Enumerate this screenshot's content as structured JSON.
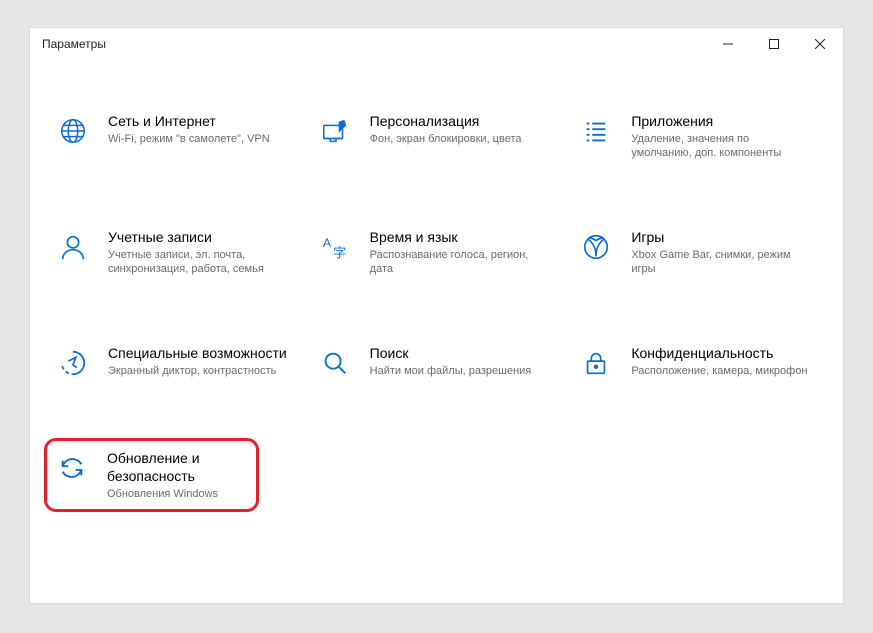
{
  "window": {
    "title": "Параметры"
  },
  "tiles": {
    "network": {
      "title": "Сеть и Интернет",
      "desc": "Wi-Fi, режим \"в самолете\", VPN"
    },
    "personalize": {
      "title": "Персонализация",
      "desc": "Фон, экран блокировки, цвета"
    },
    "apps": {
      "title": "Приложения",
      "desc": "Удаление, значения по умолчанию, доп. компоненты"
    },
    "accounts": {
      "title": "Учетные записи",
      "desc": "Учетные записи, эл. почта, синхронизация, работа, семья"
    },
    "time": {
      "title": "Время и язык",
      "desc": "Распознавание голоса, регион, дата"
    },
    "gaming": {
      "title": "Игры",
      "desc": "Xbox Game Bar, снимки, режим игры"
    },
    "accessibility": {
      "title": "Специальные возможности",
      "desc": "Экранный диктор, контрастность"
    },
    "search": {
      "title": "Поиск",
      "desc": "Найти мои файлы, разрешения"
    },
    "privacy": {
      "title": "Конфиденциальность",
      "desc": "Расположение, камера, микрофон"
    },
    "update": {
      "title": "Обновление и безопасность",
      "desc": "Обновления Windows"
    }
  }
}
